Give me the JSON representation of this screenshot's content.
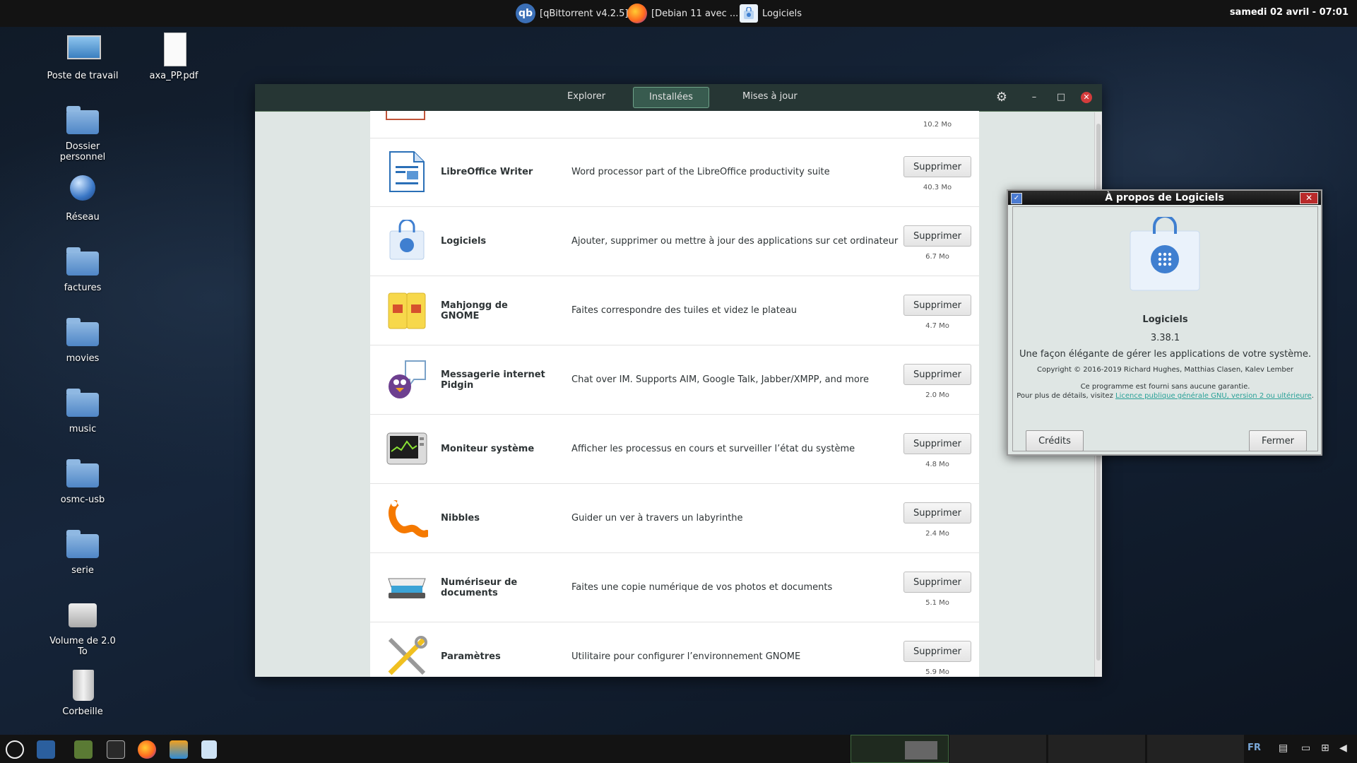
{
  "top_panel": {
    "tasks": [
      {
        "label": "[qBittorrent v4.2.5]",
        "icon": "qbittorrent-icon"
      },
      {
        "label": "[Debian 11 avec ...",
        "icon": "firefox-icon"
      },
      {
        "label": "Logiciels",
        "icon": "software-bag-icon"
      }
    ],
    "qb_glyph": "qb",
    "clock": "samedi 02 avril - 07:01"
  },
  "desktop": {
    "icons": [
      {
        "label": "Poste de travail"
      },
      {
        "label": "axa_PP.pdf"
      },
      {
        "label": "Dossier personnel"
      },
      {
        "label": "Réseau"
      },
      {
        "label": "factures"
      },
      {
        "label": "movies"
      },
      {
        "label": "music"
      },
      {
        "label": "osmc-usb"
      },
      {
        "label": "serie"
      },
      {
        "label": "Volume de 2.0 To"
      },
      {
        "label": "Corbeille"
      }
    ]
  },
  "software_window": {
    "tabs": [
      {
        "label": "Explorer"
      },
      {
        "label": "Installées"
      },
      {
        "label": "Mises à jour"
      }
    ],
    "active_tab": "Installées",
    "header_buttons": {
      "gear": "⚙",
      "minimize": "–",
      "maximize": "□",
      "close": "✕"
    },
    "partial_row_size": "10.2 Mo",
    "apps": [
      {
        "name": "LibreOffice Writer",
        "description": "Word processor part of the LibreOffice productivity suite",
        "button": "Supprimer",
        "size": "40.3 Mo",
        "icon": "libreoffice-writer-icon"
      },
      {
        "name": "Logiciels",
        "description": "Ajouter, supprimer ou mettre à jour des applications sur cet ordinateur",
        "button": "Supprimer",
        "size": "6.7 Mo",
        "icon": "software-bag-icon"
      },
      {
        "name": "Mahjongg de GNOME",
        "description": "Faites correspondre des tuiles et videz le plateau",
        "button": "Supprimer",
        "size": "4.7 Mo",
        "icon": "mahjongg-icon"
      },
      {
        "name": "Messagerie internet Pidgin",
        "description": "Chat over IM.  Supports AIM, Google Talk, Jabber/XMPP, and more",
        "button": "Supprimer",
        "size": "2.0 Mo",
        "icon": "pidgin-icon"
      },
      {
        "name": "Moniteur système",
        "description": "Afficher les processus en cours et surveiller l’état du système",
        "button": "Supprimer",
        "size": "4.8 Mo",
        "icon": "system-monitor-icon"
      },
      {
        "name": "Nibbles",
        "description": "Guider un ver à travers un labyrinthe",
        "button": "Supprimer",
        "size": "2.4 Mo",
        "icon": "nibbles-icon"
      },
      {
        "name": "Numériseur de documents",
        "description": "Faites une copie numérique de vos photos et documents",
        "button": "Supprimer",
        "size": "5.1 Mo",
        "icon": "scanner-icon"
      },
      {
        "name": "Paramètres",
        "description": "Utilitaire pour configurer l’environnement GNOME",
        "button": "Supprimer",
        "size": "5.9 Mo",
        "icon": "settings-tools-icon"
      }
    ]
  },
  "about_dialog": {
    "title": "À propos de Logiciels",
    "app_name": "Logiciels",
    "version": "3.38.1",
    "tagline": "Une façon élégante de gérer les applications de votre système.",
    "copyright": "Copyright © 2016-2019 Richard Hughes, Matthias Clasen, Kalev Lember",
    "warranty": "Ce programme est fourni sans aucune garantie.",
    "details_prefix": "Pour plus de détails, visitez ",
    "license_link": "Licence publique générale GNU, version 2 ou ultérieure",
    "details_suffix": ".",
    "credits_button": "Crédits",
    "close_button": "Fermer",
    "link_color": "#2aa198"
  },
  "bottom_panel": {
    "keyboard_layout": "FR"
  }
}
